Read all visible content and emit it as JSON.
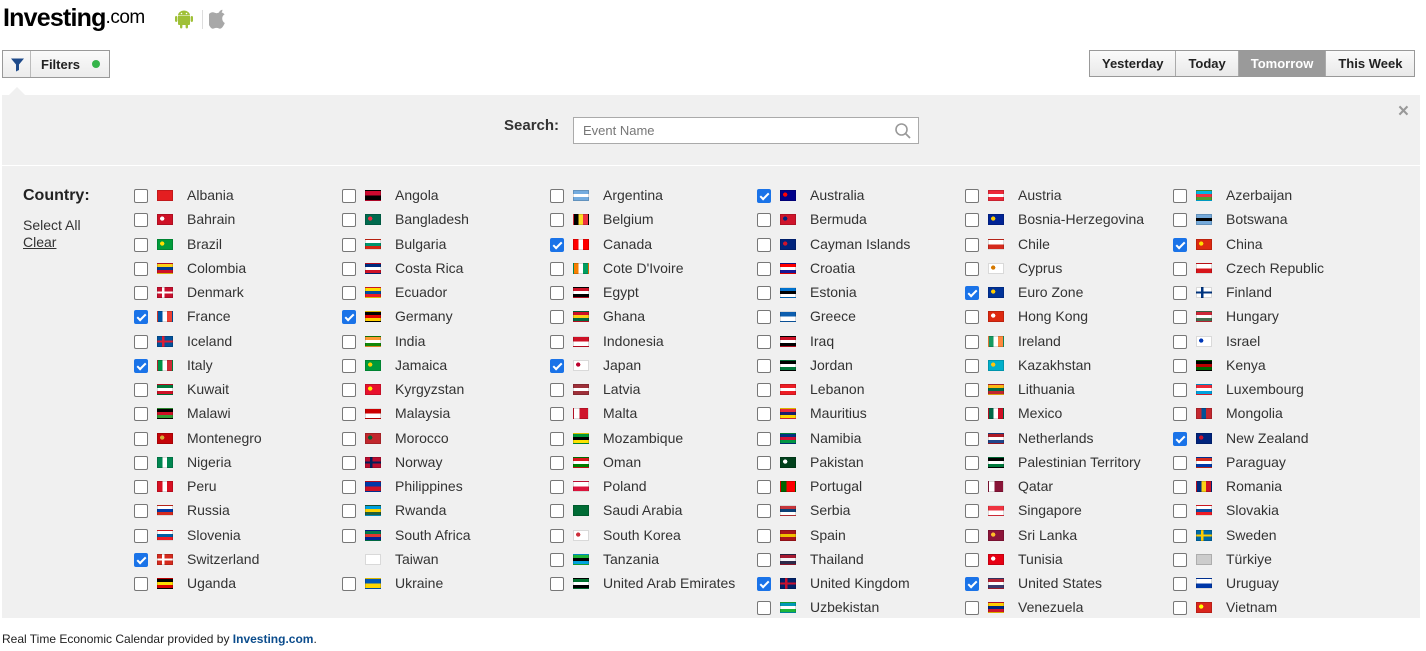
{
  "header": {
    "logo_main": "Investing",
    "logo_suffix": ".com",
    "android_color": "#9fc037",
    "apple_color": "#a8a8a8"
  },
  "filters": {
    "label": "Filters",
    "dot_color": "#35b44a"
  },
  "time_tabs": [
    {
      "label": "Yesterday",
      "active": false
    },
    {
      "label": "Today",
      "active": false
    },
    {
      "label": "Tomorrow",
      "active": true
    },
    {
      "label": "This Week",
      "active": false
    }
  ],
  "search": {
    "label": "Search:",
    "placeholder": "Event Name",
    "value": ""
  },
  "close_symbol": "×",
  "country": {
    "label": "Country:",
    "select_all": "Select All",
    "clear": "Clear",
    "checkbox_color": "#1a73e8",
    "columns": [
      [
        {
          "name": "Albania",
          "checked": false
        },
        {
          "name": "Bahrain",
          "checked": false
        },
        {
          "name": "Brazil",
          "checked": false
        },
        {
          "name": "Colombia",
          "checked": false
        },
        {
          "name": "Denmark",
          "checked": false
        },
        {
          "name": "France",
          "checked": true
        },
        {
          "name": "Iceland",
          "checked": false
        },
        {
          "name": "Italy",
          "checked": true
        },
        {
          "name": "Kuwait",
          "checked": false
        },
        {
          "name": "Malawi",
          "checked": false
        },
        {
          "name": "Montenegro",
          "checked": false
        },
        {
          "name": "Nigeria",
          "checked": false
        },
        {
          "name": "Peru",
          "checked": false
        },
        {
          "name": "Russia",
          "checked": false
        },
        {
          "name": "Slovenia",
          "checked": false
        },
        {
          "name": "Switzerland",
          "checked": true
        },
        {
          "name": "Uganda",
          "checked": false
        }
      ],
      [
        {
          "name": "Angola",
          "checked": false
        },
        {
          "name": "Bangladesh",
          "checked": false
        },
        {
          "name": "Bulgaria",
          "checked": false
        },
        {
          "name": "Costa Rica",
          "checked": false
        },
        {
          "name": "Ecuador",
          "checked": false
        },
        {
          "name": "Germany",
          "checked": true
        },
        {
          "name": "India",
          "checked": false
        },
        {
          "name": "Jamaica",
          "checked": false
        },
        {
          "name": "Kyrgyzstan",
          "checked": false
        },
        {
          "name": "Malaysia",
          "checked": false
        },
        {
          "name": "Morocco",
          "checked": false
        },
        {
          "name": "Norway",
          "checked": false
        },
        {
          "name": "Philippines",
          "checked": false
        },
        {
          "name": "Rwanda",
          "checked": false
        },
        {
          "name": "South Africa",
          "checked": false
        },
        {
          "name": "Taiwan",
          "checked": false,
          "no_checkbox": true
        },
        {
          "name": "Ukraine",
          "checked": false
        }
      ],
      [
        {
          "name": "Argentina",
          "checked": false
        },
        {
          "name": "Belgium",
          "checked": false
        },
        {
          "name": "Canada",
          "checked": true
        },
        {
          "name": "Cote D'Ivoire",
          "checked": false
        },
        {
          "name": "Egypt",
          "checked": false
        },
        {
          "name": "Ghana",
          "checked": false
        },
        {
          "name": "Indonesia",
          "checked": false
        },
        {
          "name": "Japan",
          "checked": true
        },
        {
          "name": "Latvia",
          "checked": false
        },
        {
          "name": "Malta",
          "checked": false
        },
        {
          "name": "Mozambique",
          "checked": false
        },
        {
          "name": "Oman",
          "checked": false
        },
        {
          "name": "Poland",
          "checked": false
        },
        {
          "name": "Saudi Arabia",
          "checked": false
        },
        {
          "name": "South Korea",
          "checked": false
        },
        {
          "name": "Tanzania",
          "checked": false
        },
        {
          "name": "United Arab Emirates",
          "checked": false
        }
      ],
      [
        {
          "name": "Australia",
          "checked": true
        },
        {
          "name": "Bermuda",
          "checked": false
        },
        {
          "name": "Cayman Islands",
          "checked": false
        },
        {
          "name": "Croatia",
          "checked": false
        },
        {
          "name": "Estonia",
          "checked": false
        },
        {
          "name": "Greece",
          "checked": false
        },
        {
          "name": "Iraq",
          "checked": false
        },
        {
          "name": "Jordan",
          "checked": false
        },
        {
          "name": "Lebanon",
          "checked": false
        },
        {
          "name": "Mauritius",
          "checked": false
        },
        {
          "name": "Namibia",
          "checked": false
        },
        {
          "name": "Pakistan",
          "checked": false
        },
        {
          "name": "Portugal",
          "checked": false
        },
        {
          "name": "Serbia",
          "checked": false
        },
        {
          "name": "Spain",
          "checked": false
        },
        {
          "name": "Thailand",
          "checked": false
        },
        {
          "name": "United Kingdom",
          "checked": true
        },
        {
          "name": "Uzbekistan",
          "checked": false
        }
      ],
      [
        {
          "name": "Austria",
          "checked": false
        },
        {
          "name": "Bosnia-Herzegovina",
          "checked": false
        },
        {
          "name": "Chile",
          "checked": false
        },
        {
          "name": "Cyprus",
          "checked": false
        },
        {
          "name": "Euro Zone",
          "checked": true
        },
        {
          "name": "Hong Kong",
          "checked": false
        },
        {
          "name": "Ireland",
          "checked": false
        },
        {
          "name": "Kazakhstan",
          "checked": false
        },
        {
          "name": "Lithuania",
          "checked": false
        },
        {
          "name": "Mexico",
          "checked": false
        },
        {
          "name": "Netherlands",
          "checked": false
        },
        {
          "name": "Palestinian Territory",
          "checked": false
        },
        {
          "name": "Qatar",
          "checked": false
        },
        {
          "name": "Singapore",
          "checked": false
        },
        {
          "name": "Sri Lanka",
          "checked": false
        },
        {
          "name": "Tunisia",
          "checked": false
        },
        {
          "name": "United States",
          "checked": true
        },
        {
          "name": "Venezuela",
          "checked": false
        }
      ],
      [
        {
          "name": "Azerbaijan",
          "checked": false
        },
        {
          "name": "Botswana",
          "checked": false
        },
        {
          "name": "China",
          "checked": true
        },
        {
          "name": "Czech Republic",
          "checked": false
        },
        {
          "name": "Finland",
          "checked": false
        },
        {
          "name": "Hungary",
          "checked": false
        },
        {
          "name": "Israel",
          "checked": false
        },
        {
          "name": "Kenya",
          "checked": false
        },
        {
          "name": "Luxembourg",
          "checked": false
        },
        {
          "name": "Mongolia",
          "checked": false
        },
        {
          "name": "New Zealand",
          "checked": true
        },
        {
          "name": "Paraguay",
          "checked": false
        },
        {
          "name": "Romania",
          "checked": false
        },
        {
          "name": "Slovakia",
          "checked": false
        },
        {
          "name": "Sweden",
          "checked": false
        },
        {
          "name": "Türkiye",
          "checked": false
        },
        {
          "name": "Uruguay",
          "checked": false
        },
        {
          "name": "Vietnam",
          "checked": false
        }
      ]
    ]
  },
  "footer": {
    "text": "Real Time Economic Calendar provided by ",
    "link": "Investing.com",
    "period": "."
  }
}
